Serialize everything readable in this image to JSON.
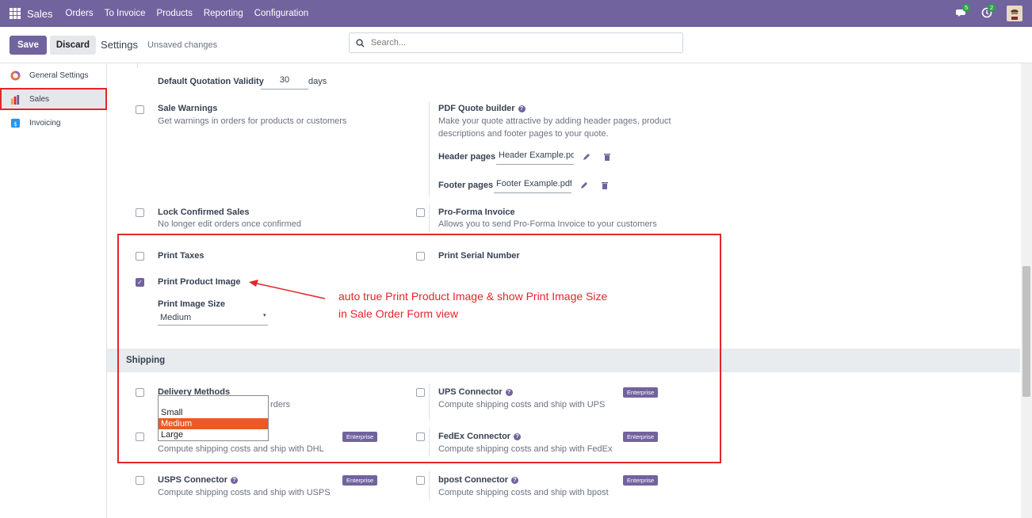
{
  "navbar": {
    "app_name": "Sales",
    "menu": [
      "Orders",
      "To Invoice",
      "Products",
      "Reporting",
      "Configuration"
    ],
    "messages_count": "5",
    "activities_count": "2"
  },
  "control_panel": {
    "save_label": "Save",
    "discard_label": "Discard",
    "title": "Settings",
    "status": "Unsaved changes",
    "search_placeholder": "Search..."
  },
  "sidebar": {
    "items": [
      {
        "label": "General Settings",
        "icon": "odoo-logo-icon"
      },
      {
        "label": "Sales",
        "icon": "sales-chart-icon",
        "active": true
      },
      {
        "label": "Invoicing",
        "icon": "invoicing-icon"
      }
    ]
  },
  "settings": {
    "quotation_validity_label": "Default Quotation Validity",
    "quotation_validity_value": "30",
    "quotation_validity_unit": "days",
    "sale_warnings": {
      "title": "Sale Warnings",
      "desc": "Get warnings in orders for products or customers",
      "checked": false
    },
    "pdf_quote_builder": {
      "title": "PDF Quote builder",
      "desc": "Make your quote attractive by adding header pages, product descriptions and footer pages to your quote.",
      "header_label": "Header pages",
      "header_value": "Header Example.pd",
      "footer_label": "Footer pages",
      "footer_value": "Footer Example.pdf"
    },
    "lock_confirmed": {
      "title": "Lock Confirmed Sales",
      "desc": "No longer edit orders once confirmed",
      "checked": false
    },
    "pro_forma": {
      "title": "Pro-Forma Invoice",
      "desc": "Allows you to send Pro-Forma Invoice to your customers",
      "checked": false
    },
    "print_taxes": {
      "title": "Print Taxes",
      "checked": false
    },
    "print_serial": {
      "title": "Print Serial Number",
      "checked": false
    },
    "print_product_image": {
      "title": "Print Product Image",
      "checked": true
    },
    "print_image_size": {
      "label": "Print Image Size",
      "value": "Medium",
      "options": [
        "Small",
        "Medium",
        "Large"
      ]
    }
  },
  "shipping": {
    "header": "Shipping",
    "delivery_methods": {
      "title": "Delivery Methods",
      "desc_visible": "rders"
    },
    "dhl": {
      "desc": "Compute shipping costs and ship with DHL"
    },
    "ups": {
      "title": "UPS Connector",
      "desc": "Compute shipping costs and ship with UPS"
    },
    "fedex": {
      "title": "FedEx Connector",
      "desc": "Compute shipping costs and ship with FedEx"
    },
    "usps": {
      "title": "USPS Connector",
      "desc": "Compute shipping costs and ship with USPS"
    },
    "bpost": {
      "title": "bpost Connector",
      "desc": "Compute shipping costs and ship with bpost"
    },
    "enterprise_label": "Enterprise"
  },
  "annotation": {
    "line1": "auto true Print Product Image & show Print Image Size",
    "line2": "in Sale Order Form view"
  },
  "colors": {
    "brand": "#71639e",
    "highlight": "#e3262b",
    "dropdown_selected": "#ea5a27"
  }
}
